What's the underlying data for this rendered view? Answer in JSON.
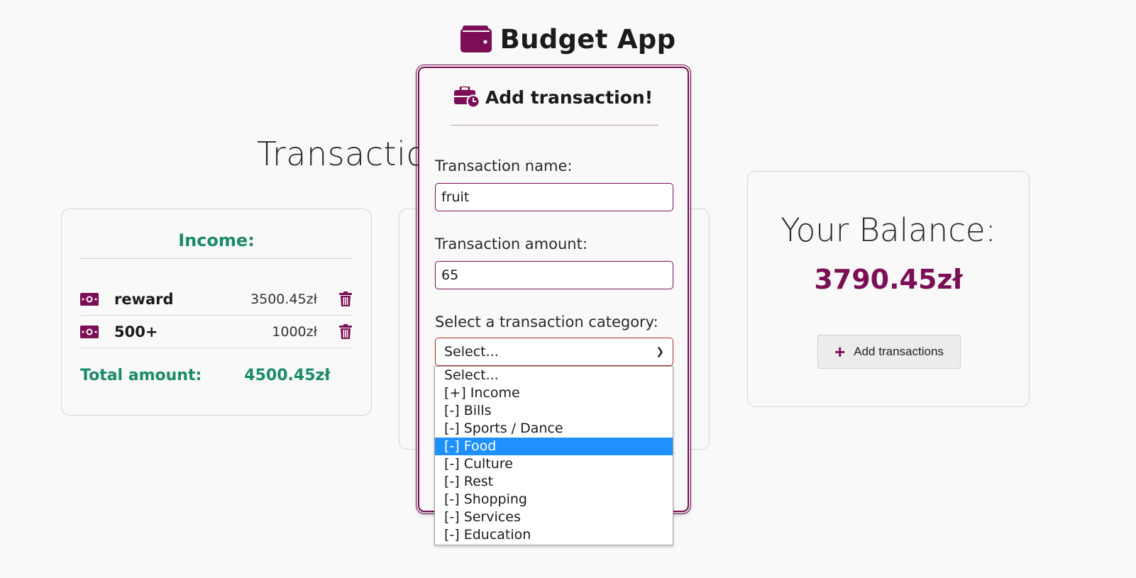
{
  "app": {
    "title": "Budget App",
    "icon": "wallet-icon"
  },
  "page": {
    "section_title": "Transactions"
  },
  "income": {
    "title": "Income:",
    "items": [
      {
        "name": "reward",
        "amount": "3500.45zł",
        "icon": "money-bill-icon"
      },
      {
        "name": "500+",
        "amount": "1000zł",
        "icon": "money-bill-icon"
      }
    ],
    "total_label": "Total amount:",
    "total_value": "4500.45zł"
  },
  "balance": {
    "label": "Your Balance:",
    "value": "3790.45zł",
    "add_button": "Add transactions"
  },
  "modal": {
    "title": "Add transaction!",
    "name_label": "Transaction name:",
    "name_value": "fruit",
    "amount_label": "Transaction amount:",
    "amount_value": "65",
    "category_label": "Select a transaction category:",
    "category_value": "Select...",
    "options": [
      "Select...",
      "[+] Income",
      "[-] Bills",
      "[-] Sports / Dance",
      "[-] Food",
      "[-] Culture",
      "[-] Rest",
      "[-] Shopping",
      "[-] Services",
      "[-] Education"
    ],
    "highlighted_option": "[-] Food"
  },
  "colors": {
    "accent": "#7b0e55",
    "income_green": "#1b8a6b",
    "highlight_blue": "#1e90ff"
  }
}
